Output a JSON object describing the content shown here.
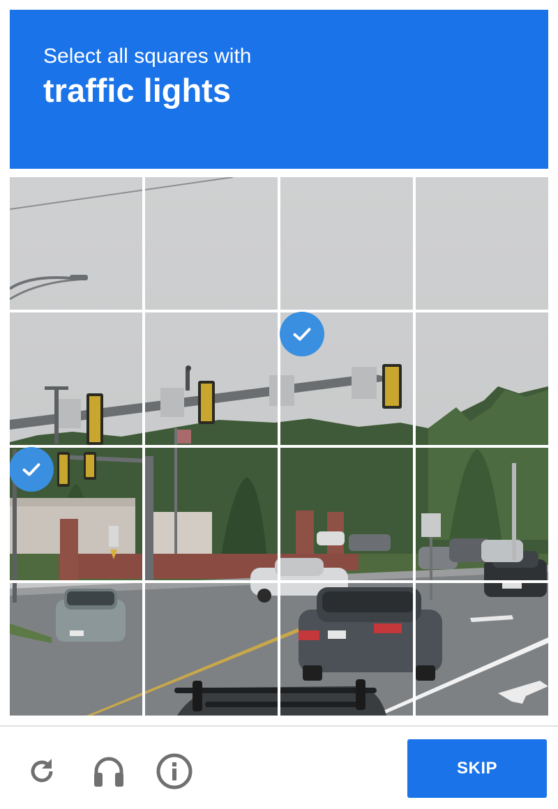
{
  "header": {
    "instruction": "Select all squares with",
    "target": "traffic lights",
    "background_color": "#1a73e8"
  },
  "grid": {
    "rows": 4,
    "columns": 4,
    "selected_tiles": [
      [
        1,
        2
      ],
      [
        2,
        0
      ]
    ]
  },
  "footer": {
    "reload_icon": "reload-icon",
    "audio_icon": "headphones-icon",
    "info_icon": "info-icon",
    "skip_label": "SKIP"
  },
  "colors": {
    "accent": "#1a73e8",
    "check_badge": "#3b8fe0",
    "icon_gray": "#707070"
  }
}
